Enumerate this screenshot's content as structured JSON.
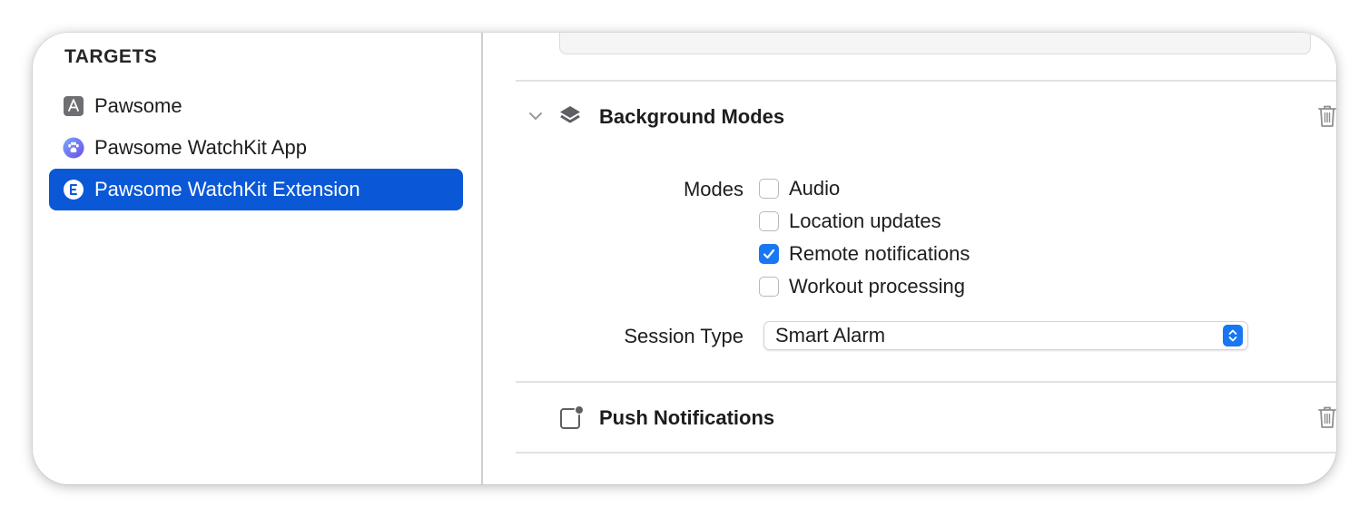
{
  "sidebar": {
    "header": "TARGETS",
    "items": [
      {
        "label": "Pawsome",
        "icon": "app-store-icon",
        "selected": false
      },
      {
        "label": "Pawsome WatchKit App",
        "icon": "paw-icon",
        "selected": false
      },
      {
        "label": "Pawsome WatchKit Extension",
        "icon": "extension-e-icon",
        "selected": true
      }
    ]
  },
  "background_modes": {
    "title": "Background Modes",
    "modes_label": "Modes",
    "modes": [
      {
        "label": "Audio",
        "checked": false
      },
      {
        "label": "Location updates",
        "checked": false
      },
      {
        "label": "Remote notifications",
        "checked": true
      },
      {
        "label": "Workout processing",
        "checked": false
      }
    ],
    "session_type_label": "Session Type",
    "session_type_value": "Smart Alarm"
  },
  "push_notifications": {
    "title": "Push Notifications"
  },
  "colors": {
    "accent": "#1877f2",
    "selection": "#0a58d6"
  }
}
